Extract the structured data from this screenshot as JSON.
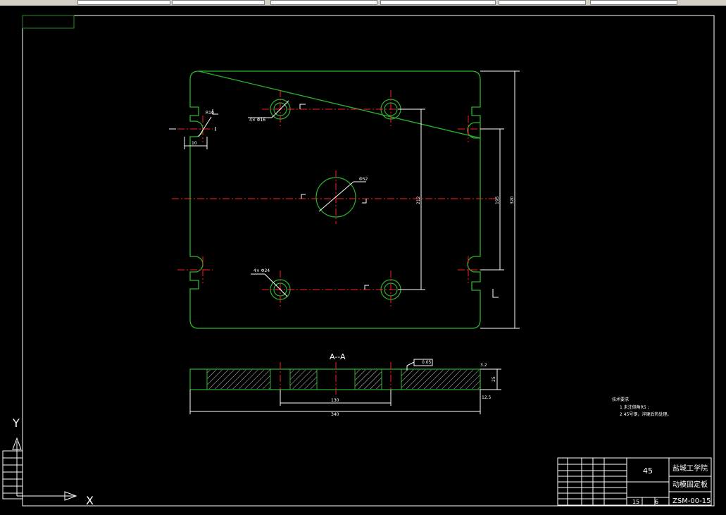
{
  "toolbar": {
    "segments": [
      "",
      "",
      "",
      "",
      "",
      "",
      ""
    ]
  },
  "drawing": {
    "section_label": "A--A",
    "dim_overall_width": "340",
    "dim_bolt_spacing": "130",
    "dim_vertical_inner": "212",
    "dim_vertical_mid": "195",
    "dim_vertical_outer": "320",
    "dim_thickness": "25",
    "dim_slot_width": "10",
    "dim_slot_radius": "R10",
    "dim_center_hole": "Φ52",
    "dim_hole_top": "4× Φ16",
    "dim_hole_bottom": "4× Φ24",
    "tolerance_frame": "0.05",
    "roughness_top": "3.2",
    "roughness_bottom": "12.5",
    "section_marker": "A",
    "notes_title": "技术要求",
    "notes_line1": "1  未注倒角R5 ;",
    "notes_line2": "2  45号钢，淬硬后热处理。"
  },
  "title_block": {
    "material": "45",
    "school": "盐城工学院",
    "part_name": "动模固定板",
    "drawing_number": "ZSM-00-15",
    "scale": "15",
    "sheet": "6"
  },
  "ucs": {
    "x_label": "X",
    "y_label": "Y"
  }
}
